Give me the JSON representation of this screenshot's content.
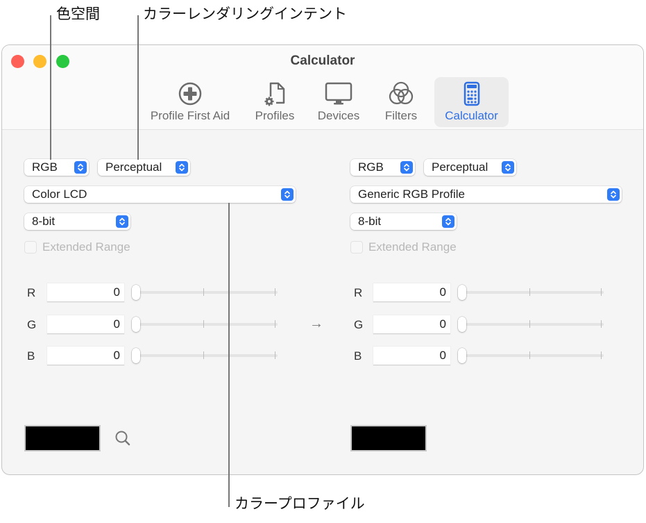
{
  "callouts": {
    "color_space": "色空間",
    "rendering_intent": "カラーレンダリングインテント",
    "color_profile": "カラープロファイル"
  },
  "window": {
    "title": "Calculator",
    "traffic_lights": [
      "close",
      "minimize",
      "zoom"
    ]
  },
  "toolbar": {
    "items": [
      {
        "label": "Profile First Aid",
        "icon": "plus-circle-icon",
        "active": false
      },
      {
        "label": "Profiles",
        "icon": "document-gear-icon",
        "active": false
      },
      {
        "label": "Devices",
        "icon": "display-icon",
        "active": false
      },
      {
        "label": "Filters",
        "icon": "overlapping-circles-icon",
        "active": false
      },
      {
        "label": "Calculator",
        "icon": "calculator-icon",
        "active": true
      }
    ],
    "accent_color": "#2f6fe4"
  },
  "source": {
    "color_space": "RGB",
    "rendering_intent": "Perceptual",
    "profile": "Color LCD",
    "bit_depth": "8-bit",
    "extended_range_label": "Extended Range",
    "extended_range_checked": false,
    "channels": [
      {
        "label": "R",
        "value": "0",
        "slider_fraction": 0
      },
      {
        "label": "G",
        "value": "0",
        "slider_fraction": 0
      },
      {
        "label": "B",
        "value": "0",
        "slider_fraction": 0
      }
    ],
    "swatch_color": "#000000"
  },
  "arrow": "→",
  "destination": {
    "color_space": "RGB",
    "rendering_intent": "Perceptual",
    "profile": "Generic RGB Profile",
    "bit_depth": "8-bit",
    "extended_range_label": "Extended Range",
    "extended_range_checked": false,
    "channels": [
      {
        "label": "R",
        "value": "0",
        "slider_fraction": 0
      },
      {
        "label": "G",
        "value": "0",
        "slider_fraction": 0
      },
      {
        "label": "B",
        "value": "0",
        "slider_fraction": 0
      }
    ],
    "swatch_color": "#000000"
  }
}
